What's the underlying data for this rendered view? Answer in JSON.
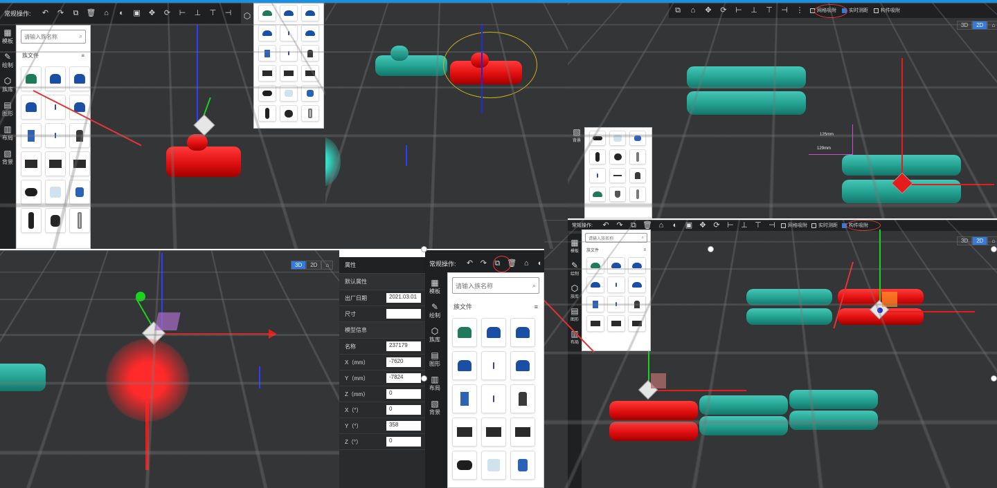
{
  "toolbar": {
    "label": "常规操作:",
    "checks": [
      "网格吸附",
      "实时测距",
      "构件吸附"
    ]
  },
  "nav": [
    "模板",
    "绘制",
    "族库",
    "图形",
    "布局",
    "背景"
  ],
  "library": {
    "search_placeholder": "请输入族名称",
    "folder_label": "族文件"
  },
  "view_modes": [
    "3D",
    "2D"
  ],
  "properties": {
    "title": "属性",
    "default_section": "默认属性",
    "model_section": "模型信息",
    "rows_default": [
      {
        "label": "出厂日期",
        "value": "2021.03.01"
      },
      {
        "label": "尺寸",
        "value": ""
      }
    ],
    "rows_model": [
      {
        "label": "名称",
        "value": "237179"
      },
      {
        "label": "X（mm）",
        "value": "-7620"
      },
      {
        "label": "Y（mm）",
        "value": "-7824"
      },
      {
        "label": "Z（mm）",
        "value": "0"
      },
      {
        "label": "X（°）",
        "value": "0"
      },
      {
        "label": "Y（°）",
        "value": "358"
      },
      {
        "label": "Z（°）",
        "value": "0"
      }
    ]
  },
  "dimensions": [
    "125mm",
    "129mm"
  ]
}
